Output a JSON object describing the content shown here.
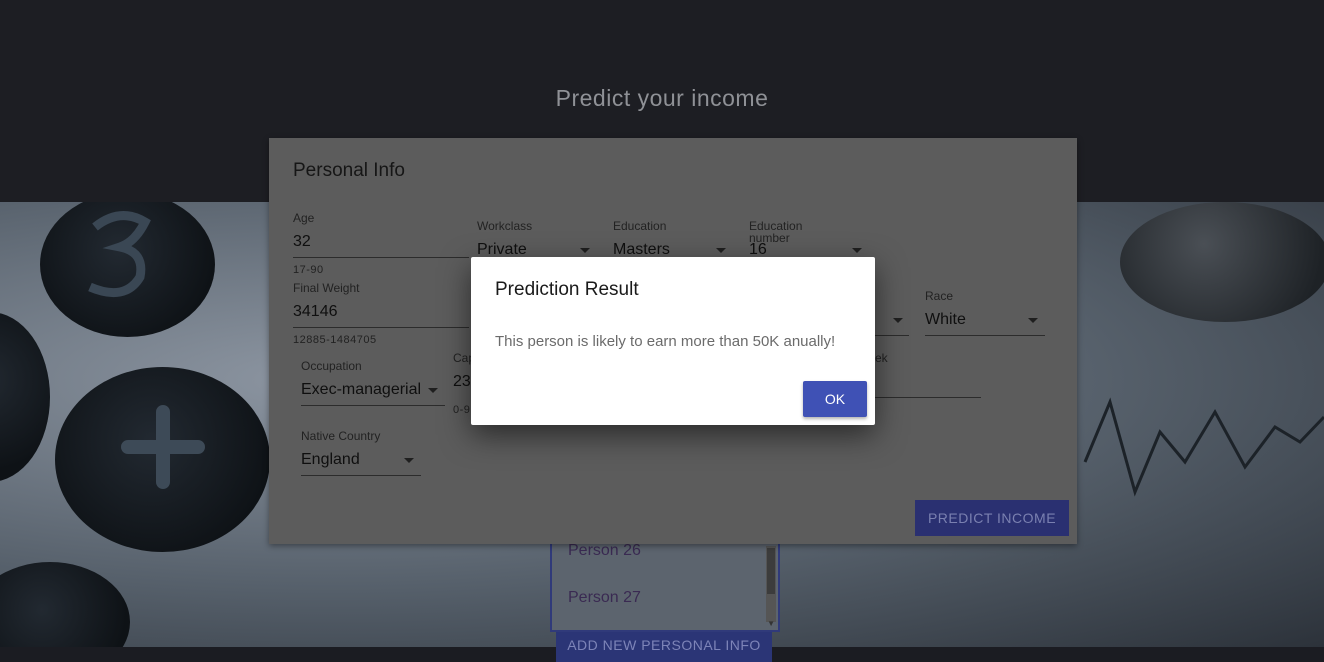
{
  "header": {
    "title": "Predict your income"
  },
  "person_list": {
    "items": [
      "Person 26",
      "Person 27"
    ]
  },
  "add_button_label": "ADD NEW PERSONAL INFO",
  "card": {
    "title": "Personal Info",
    "age": {
      "label": "Age",
      "value": "32",
      "help": "17-90"
    },
    "workclass": {
      "label": "Workclass",
      "value": "Private"
    },
    "education": {
      "label": "Education",
      "value": "Masters"
    },
    "education_number": {
      "label": "Education number",
      "value": "16"
    },
    "final_weight": {
      "label": "Final Weight",
      "value": "34146",
      "help": "12885-1484705"
    },
    "race": {
      "label": "Race",
      "value": "White"
    },
    "occupation": {
      "label": "Occupation",
      "value": "Exec-managerial"
    },
    "capital_gain": {
      "label_visible": "Cap",
      "value_visible": "23",
      "help_visible": "0-9"
    },
    "hours_per_week": {
      "label_visible": "ek"
    },
    "native_country": {
      "label": "Native Country",
      "value": "England"
    },
    "predict_button": "PREDICT INCOME"
  },
  "dialog": {
    "title": "Prediction Result",
    "message": "This person is likely to earn more than 50K anually!",
    "ok_label": "OK"
  },
  "colors": {
    "primary": "#3f51b5",
    "overlay_header": "#1d1e23",
    "dialog_bg": "#ffffff"
  },
  "icons": [
    "dropdown-caret-icon",
    "scroll-down-arrow-icon"
  ]
}
